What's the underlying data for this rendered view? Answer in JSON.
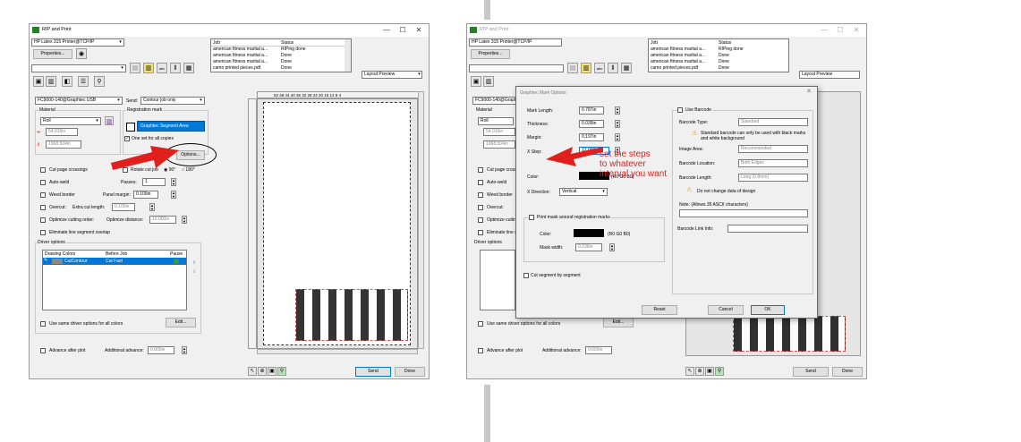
{
  "left": {
    "title": "RIP and Print",
    "printer": "HP Latex 315 Printer@TCP/IP",
    "properties": "Properties...",
    "job_headers": [
      "Job",
      "Status"
    ],
    "jobs": [
      [
        "american fitness martial a...",
        "RIPing done"
      ],
      [
        "american fitness martial a...",
        "Done"
      ],
      [
        "american fitness martial a...",
        "Done"
      ],
      [
        "camo printed pieces.pdf",
        "Done"
      ]
    ],
    "preview_mode": "Layout Preview",
    "cutter": "FC9000-140@Graphtec USB",
    "send_label": "Send:",
    "send_value": "Contour job only",
    "material_label": "Material",
    "material_value": "Roll",
    "width_value": "54.016in",
    "length_value": "1968.504in",
    "reg_label": "Registration mark",
    "reg_value": "Graphtec Segment Area",
    "one_set": "One set for all copies",
    "options": "Options...",
    "cut_crossings": "Cut page crossings",
    "rotate": "Rotate cut job",
    "deg90": "90°",
    "deg180": "180°",
    "auto_weld": "Auto-weld",
    "passes_label": "Passes:",
    "passes": "1",
    "weed": "Weed border",
    "panel_label": "Panel margin:",
    "panel": "0.100in",
    "overcut": "Overcut:",
    "extra_label": "Extra cut length:",
    "extra": "0.100in",
    "optimize": "Optimize cutting order:",
    "opt_dist_label": "Optimize distance:",
    "opt_dist": "10.000in",
    "eliminate": "Eliminate line segment overlap",
    "driver": "Driver options",
    "drv_headers": [
      "Drawing Colors",
      "Before Job",
      "Pause"
    ],
    "drv_row": [
      "CutContour",
      "Cut Fast"
    ],
    "same_driver": "Use same driver options for all colors",
    "edit": "Edit...",
    "advance": "Advance after plot",
    "add_adv_label": "Additional advance:",
    "add_adv": "0.000in",
    "send": "Send",
    "done": "Done",
    "ruler": "52 48 44 40 36 32 28 24 20 16 12 8 4"
  },
  "dialog": {
    "title": "Graphtec Mark Options",
    "mark_length_label": "Mark Length:",
    "mark_length": "0.787in",
    "thickness_label": "Thickness:",
    "thickness": "0.039in",
    "margin_label": "Margin:",
    "margin": "0.197in",
    "xstep_label": "X Step:",
    "xstep": "12.000in",
    "color_label": "Color:",
    "color_value": "(R0 G0 B0)",
    "xdir_label": "X Direction:",
    "xdir": "Vertical",
    "print_mask": "Print mask around registration marks",
    "mask_color_label": "Color:",
    "mask_color_value": "(R0 G0 B0)",
    "mask_width_label": "Mask width:",
    "mask_width": "0.236in",
    "cut_segment": "Cut segment by segment",
    "use_barcode": "Use Barcode",
    "barcode_type_label": "Barcode Type:",
    "barcode_type": "Standard",
    "warn1": "Standard barcode can only be used with black marks and white background",
    "image_area_label": "Image Area:",
    "image_area": "Recommended",
    "barcode_loc_label": "Barcode Location:",
    "barcode_loc": "Both Edges",
    "barcode_len_label": "Barcode Length:",
    "barcode_len": "Long (0.8mm)",
    "warn2": "Do not change data of design",
    "note_label": "Note: (Allows 35 ASCII characters)",
    "barcode_link_label": "Barcode Link Info:",
    "reset": "Reset",
    "cancel": "Cancel",
    "ok": "OK"
  },
  "annotation": "set the steps\nto whatever\ninterval you want",
  "colors": {
    "arrow": "#e0201c",
    "accent": "#0078d7"
  }
}
